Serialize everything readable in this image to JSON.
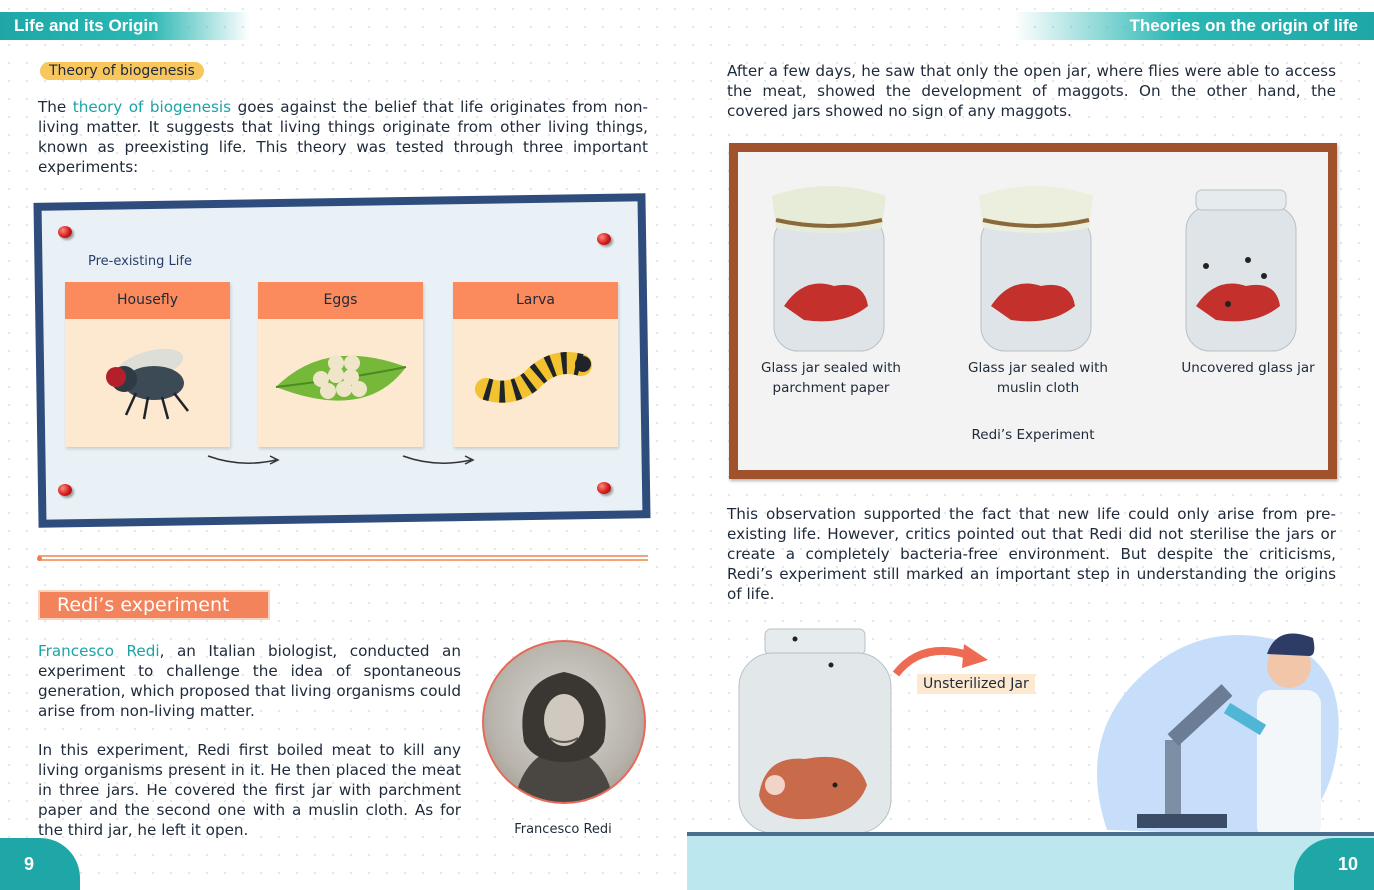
{
  "left": {
    "header": "Life and its  Origin",
    "section_tag": "Theory of biogenesis",
    "intro": {
      "p1": "The ",
      "term": "theory of biogenesis",
      "p2": " goes against the belief that life originates from non-living matter. It suggests that living things originate from other living things, known as preexisting life. This theory was tested through three important experiments:"
    },
    "board": {
      "label": "Pre-existing Life",
      "cards": [
        "Housefly",
        "Eggs",
        "Larva"
      ]
    },
    "redi_heading": "Redi’s experiment",
    "redi_p1": {
      "name": "Francesco Redi",
      "rest": ", an Italian biologist, conducted an experiment to challenge the idea of spontaneous generation, which proposed that living organisms could arise from non-living matter."
    },
    "redi_p2": "In this experiment, Redi first boiled meat to kill any living organisms present in it. He then placed the meat in three jars. He covered the first jar with parchment paper and the second one with a muslin cloth. As for the third jar, he left it open.",
    "portrait_caption": "Francesco Redi",
    "page_number": "9"
  },
  "right": {
    "header": "Theories on the origin of life",
    "para1": "After a few days, he saw that only the open jar, where flies were able to access the meat, showed the development of maggots. On the other hand, the covered jars showed no sign of any maggots.",
    "jars": [
      {
        "caption": "Glass jar sealed with parchment paper"
      },
      {
        "caption": "Glass jar sealed with muslin cloth"
      },
      {
        "caption": "Uncovered glass jar"
      }
    ],
    "frame_title": "Redi’s Experiment",
    "para2": "This observation supported the fact that new life could only arise from pre-existing life. However, critics pointed out that Redi did not sterilise the jars or create a completely bacteria-free environment. But despite the criticisms, Redi’s experiment still marked an important step in understanding the origins of life.",
    "unsterilized_label": "Unsterilized Jar",
    "page_number": "10"
  }
}
